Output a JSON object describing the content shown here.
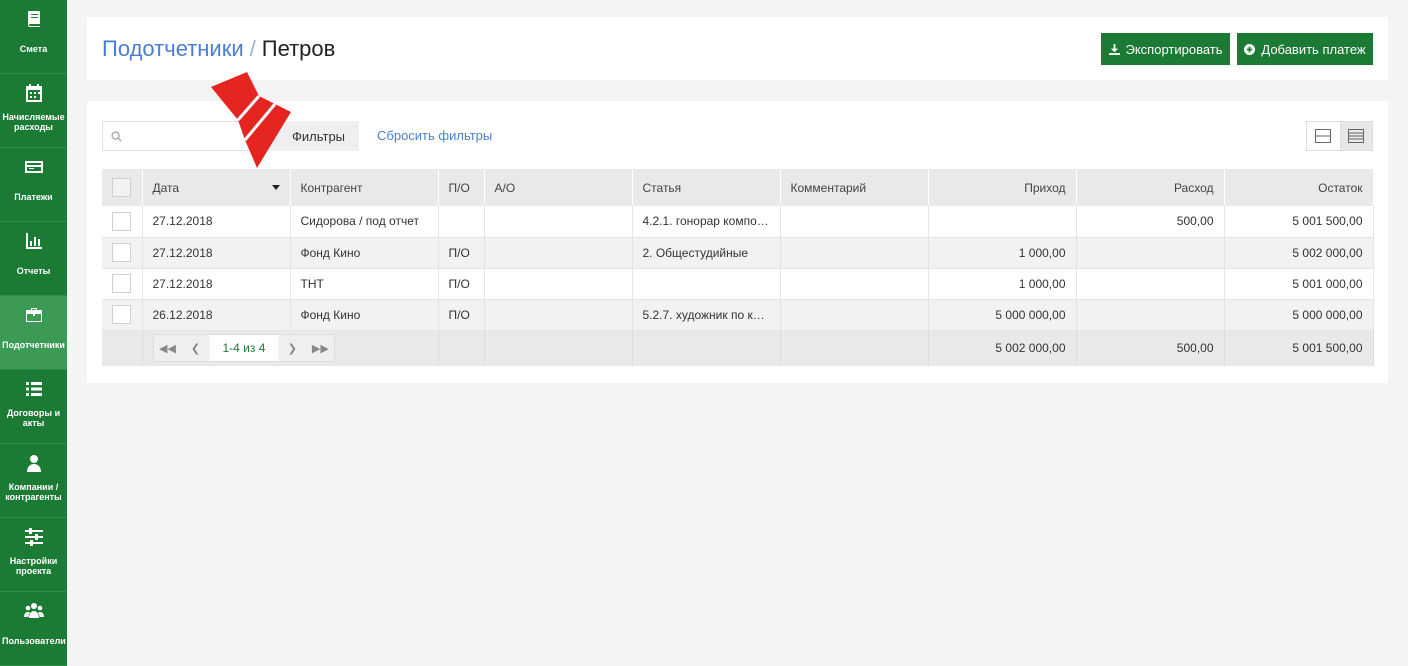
{
  "colors": {
    "brand_green": "#1b7a34",
    "sidebar_active": "#3c9a55",
    "link_blue": "#4a7fd0",
    "arrow_red": "#e52620"
  },
  "sidebar": {
    "items": [
      {
        "label": "Смета",
        "icon": "book-icon"
      },
      {
        "label": "Начисляемые расходы",
        "icon": "calendar-icon"
      },
      {
        "label": "Платежи",
        "icon": "credit-card-icon"
      },
      {
        "label": "Отчеты",
        "icon": "bar-chart-icon"
      },
      {
        "label": "Подотчетники",
        "icon": "briefcase-icon",
        "active": true
      },
      {
        "label": "Договоры и акты",
        "icon": "list-icon"
      },
      {
        "label": "Компании / контрагенты",
        "icon": "user-icon"
      },
      {
        "label": "Настройки проекта",
        "icon": "sliders-icon"
      },
      {
        "label": "Пользователи",
        "icon": "users-icon"
      }
    ]
  },
  "header": {
    "breadcrumb_link": "Подотчетники",
    "breadcrumb_sep": "/",
    "breadcrumb_current": "Петров",
    "export_label": "Экспортировать",
    "add_payment_label": "Добавить платеж"
  },
  "toolbar": {
    "search_placeholder": "",
    "filters_label": "Фильтры",
    "reset_filters_label": "Сбросить фильтры"
  },
  "table": {
    "columns": [
      "Дата",
      "Контрагент",
      "П/О",
      "А/О",
      "Статья",
      "Комментарий",
      "Приход",
      "Расход",
      "Остаток"
    ],
    "rows": [
      {
        "date": "27.12.2018",
        "counterparty": "Сидорова / под отчет",
        "po": "",
        "ao": "",
        "article": "4.2.1. гонорар компо…",
        "comment": "",
        "income": "",
        "expense": "500,00",
        "balance": "5 001 500,00"
      },
      {
        "date": "27.12.2018",
        "counterparty": "Фонд Кино",
        "po": "П/О",
        "ao": "",
        "article": "2. Общестудийные",
        "comment": "",
        "income": "1 000,00",
        "expense": "",
        "balance": "5 002 000,00"
      },
      {
        "date": "27.12.2018",
        "counterparty": "ТНТ",
        "po": "П/О",
        "ao": "",
        "article": "",
        "comment": "",
        "income": "1 000,00",
        "expense": "",
        "balance": "5 001 000,00"
      },
      {
        "date": "26.12.2018",
        "counterparty": "Фонд Кино",
        "po": "П/О",
        "ao": "",
        "article": "5.2.7. художник по к…",
        "comment": "",
        "income": "5 000 000,00",
        "expense": "",
        "balance": "5 000 000,00"
      }
    ],
    "totals": {
      "income": "5 002 000,00",
      "expense": "500,00",
      "balance": "5 001 500,00"
    },
    "pager_info": "1-4 из 4"
  }
}
